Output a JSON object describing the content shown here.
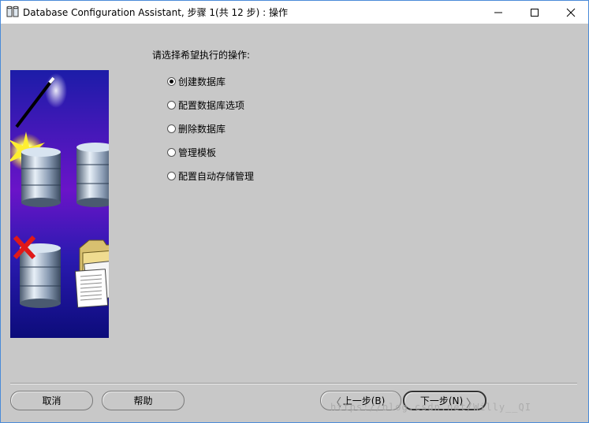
{
  "window": {
    "title": "Database Configuration Assistant, 步骤 1(共 12 步) : 操作",
    "minimize_glyph": "—",
    "maximize_glyph": "☐",
    "close_glyph": "✕"
  },
  "main": {
    "prompt": "请选择希望执行的操作:",
    "options": [
      {
        "label": "创建数据库",
        "selected": true
      },
      {
        "label": "配置数据库选项",
        "selected": false
      },
      {
        "label": "删除数据库",
        "selected": false
      },
      {
        "label": "管理模板",
        "selected": false
      },
      {
        "label": "配置自动存储管理",
        "selected": false
      }
    ]
  },
  "footer": {
    "cancel_label": "取消",
    "help_label": "帮助",
    "back_label": "上一步(B)",
    "next_label": "下一步(N)",
    "back_chevron": "〈",
    "next_chevron": "〉"
  },
  "watermark": "https://blog.csdn.net/Willy__QI",
  "colors": {
    "window_bg": "#c8c8c8",
    "title_bg": "#ffffff",
    "window_border": "#4a8ad8",
    "illustration_top": "#1c1c9a",
    "illustration_mid": "#5a10b8",
    "illustration_bottom": "#10107a"
  }
}
